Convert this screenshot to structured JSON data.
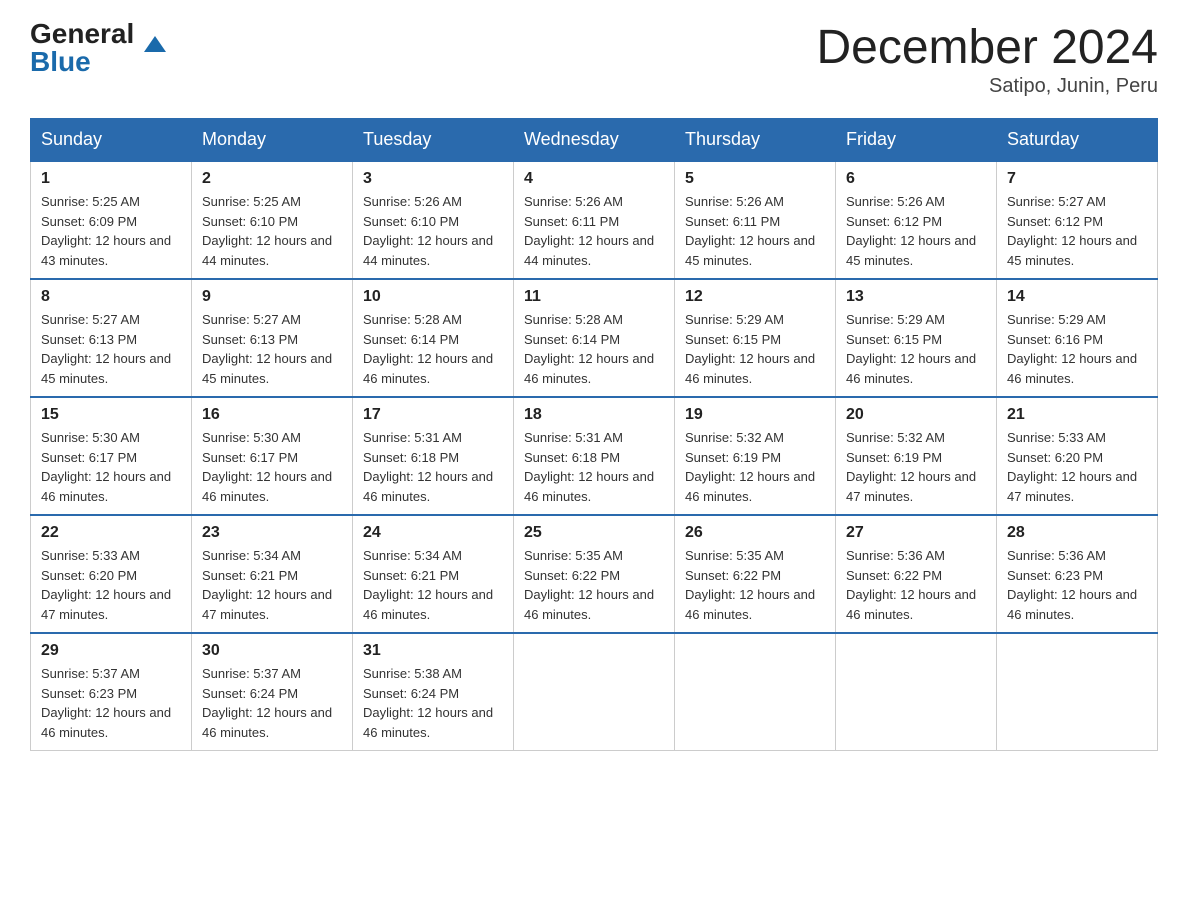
{
  "logo": {
    "general": "General",
    "blue": "Blue"
  },
  "title": "December 2024",
  "subtitle": "Satipo, Junin, Peru",
  "weekdays": [
    "Sunday",
    "Monday",
    "Tuesday",
    "Wednesday",
    "Thursday",
    "Friday",
    "Saturday"
  ],
  "weeks": [
    [
      {
        "day": "1",
        "sunrise": "5:25 AM",
        "sunset": "6:09 PM",
        "daylight": "12 hours and 43 minutes."
      },
      {
        "day": "2",
        "sunrise": "5:25 AM",
        "sunset": "6:10 PM",
        "daylight": "12 hours and 44 minutes."
      },
      {
        "day": "3",
        "sunrise": "5:26 AM",
        "sunset": "6:10 PM",
        "daylight": "12 hours and 44 minutes."
      },
      {
        "day": "4",
        "sunrise": "5:26 AM",
        "sunset": "6:11 PM",
        "daylight": "12 hours and 44 minutes."
      },
      {
        "day": "5",
        "sunrise": "5:26 AM",
        "sunset": "6:11 PM",
        "daylight": "12 hours and 45 minutes."
      },
      {
        "day": "6",
        "sunrise": "5:26 AM",
        "sunset": "6:12 PM",
        "daylight": "12 hours and 45 minutes."
      },
      {
        "day": "7",
        "sunrise": "5:27 AM",
        "sunset": "6:12 PM",
        "daylight": "12 hours and 45 minutes."
      }
    ],
    [
      {
        "day": "8",
        "sunrise": "5:27 AM",
        "sunset": "6:13 PM",
        "daylight": "12 hours and 45 minutes."
      },
      {
        "day": "9",
        "sunrise": "5:27 AM",
        "sunset": "6:13 PM",
        "daylight": "12 hours and 45 minutes."
      },
      {
        "day": "10",
        "sunrise": "5:28 AM",
        "sunset": "6:14 PM",
        "daylight": "12 hours and 46 minutes."
      },
      {
        "day": "11",
        "sunrise": "5:28 AM",
        "sunset": "6:14 PM",
        "daylight": "12 hours and 46 minutes."
      },
      {
        "day": "12",
        "sunrise": "5:29 AM",
        "sunset": "6:15 PM",
        "daylight": "12 hours and 46 minutes."
      },
      {
        "day": "13",
        "sunrise": "5:29 AM",
        "sunset": "6:15 PM",
        "daylight": "12 hours and 46 minutes."
      },
      {
        "day": "14",
        "sunrise": "5:29 AM",
        "sunset": "6:16 PM",
        "daylight": "12 hours and 46 minutes."
      }
    ],
    [
      {
        "day": "15",
        "sunrise": "5:30 AM",
        "sunset": "6:17 PM",
        "daylight": "12 hours and 46 minutes."
      },
      {
        "day": "16",
        "sunrise": "5:30 AM",
        "sunset": "6:17 PM",
        "daylight": "12 hours and 46 minutes."
      },
      {
        "day": "17",
        "sunrise": "5:31 AM",
        "sunset": "6:18 PM",
        "daylight": "12 hours and 46 minutes."
      },
      {
        "day": "18",
        "sunrise": "5:31 AM",
        "sunset": "6:18 PM",
        "daylight": "12 hours and 46 minutes."
      },
      {
        "day": "19",
        "sunrise": "5:32 AM",
        "sunset": "6:19 PM",
        "daylight": "12 hours and 46 minutes."
      },
      {
        "day": "20",
        "sunrise": "5:32 AM",
        "sunset": "6:19 PM",
        "daylight": "12 hours and 47 minutes."
      },
      {
        "day": "21",
        "sunrise": "5:33 AM",
        "sunset": "6:20 PM",
        "daylight": "12 hours and 47 minutes."
      }
    ],
    [
      {
        "day": "22",
        "sunrise": "5:33 AM",
        "sunset": "6:20 PM",
        "daylight": "12 hours and 47 minutes."
      },
      {
        "day": "23",
        "sunrise": "5:34 AM",
        "sunset": "6:21 PM",
        "daylight": "12 hours and 47 minutes."
      },
      {
        "day": "24",
        "sunrise": "5:34 AM",
        "sunset": "6:21 PM",
        "daylight": "12 hours and 46 minutes."
      },
      {
        "day": "25",
        "sunrise": "5:35 AM",
        "sunset": "6:22 PM",
        "daylight": "12 hours and 46 minutes."
      },
      {
        "day": "26",
        "sunrise": "5:35 AM",
        "sunset": "6:22 PM",
        "daylight": "12 hours and 46 minutes."
      },
      {
        "day": "27",
        "sunrise": "5:36 AM",
        "sunset": "6:22 PM",
        "daylight": "12 hours and 46 minutes."
      },
      {
        "day": "28",
        "sunrise": "5:36 AM",
        "sunset": "6:23 PM",
        "daylight": "12 hours and 46 minutes."
      }
    ],
    [
      {
        "day": "29",
        "sunrise": "5:37 AM",
        "sunset": "6:23 PM",
        "daylight": "12 hours and 46 minutes."
      },
      {
        "day": "30",
        "sunrise": "5:37 AM",
        "sunset": "6:24 PM",
        "daylight": "12 hours and 46 minutes."
      },
      {
        "day": "31",
        "sunrise": "5:38 AM",
        "sunset": "6:24 PM",
        "daylight": "12 hours and 46 minutes."
      },
      null,
      null,
      null,
      null
    ]
  ]
}
